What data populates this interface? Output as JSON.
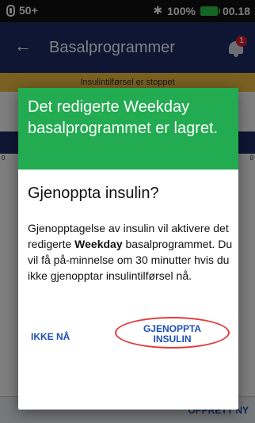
{
  "status_bar": {
    "left_text": "50+",
    "battery": "100%",
    "time": "00.18",
    "bluetooth_glyph": "✱"
  },
  "app_bar": {
    "title": "Basalprogrammer",
    "back_glyph": "←",
    "notification_count": "1"
  },
  "banner": {
    "text": "Insulintilførsel er stoppet"
  },
  "background": {
    "tick_left": "0",
    "tick_right": "0",
    "create_new_label": "OPPRETT NY"
  },
  "dialog": {
    "header": "Det redigerte Weekday basalprogrammet er lagret.",
    "title": "Gjenoppta insulin?",
    "body_before": "Gjenopptagelse av insulin vil aktivere det redigerte ",
    "body_bold": "Weekday",
    "body_after": " basalprogrammet. Du vil få på-minnelse om 30 minutter hvis du ikke gjenopptar insulintilførsel nå.",
    "not_now_label": "IKKE NÅ",
    "resume_label_line1": "GJENOPPTA",
    "resume_label_line2": "INSULIN"
  },
  "colors": {
    "app_bar": "#1e2c66",
    "dialog_header": "#22ab50",
    "accent_text": "#1e4fb5",
    "highlight_ring": "#e23a3a"
  }
}
